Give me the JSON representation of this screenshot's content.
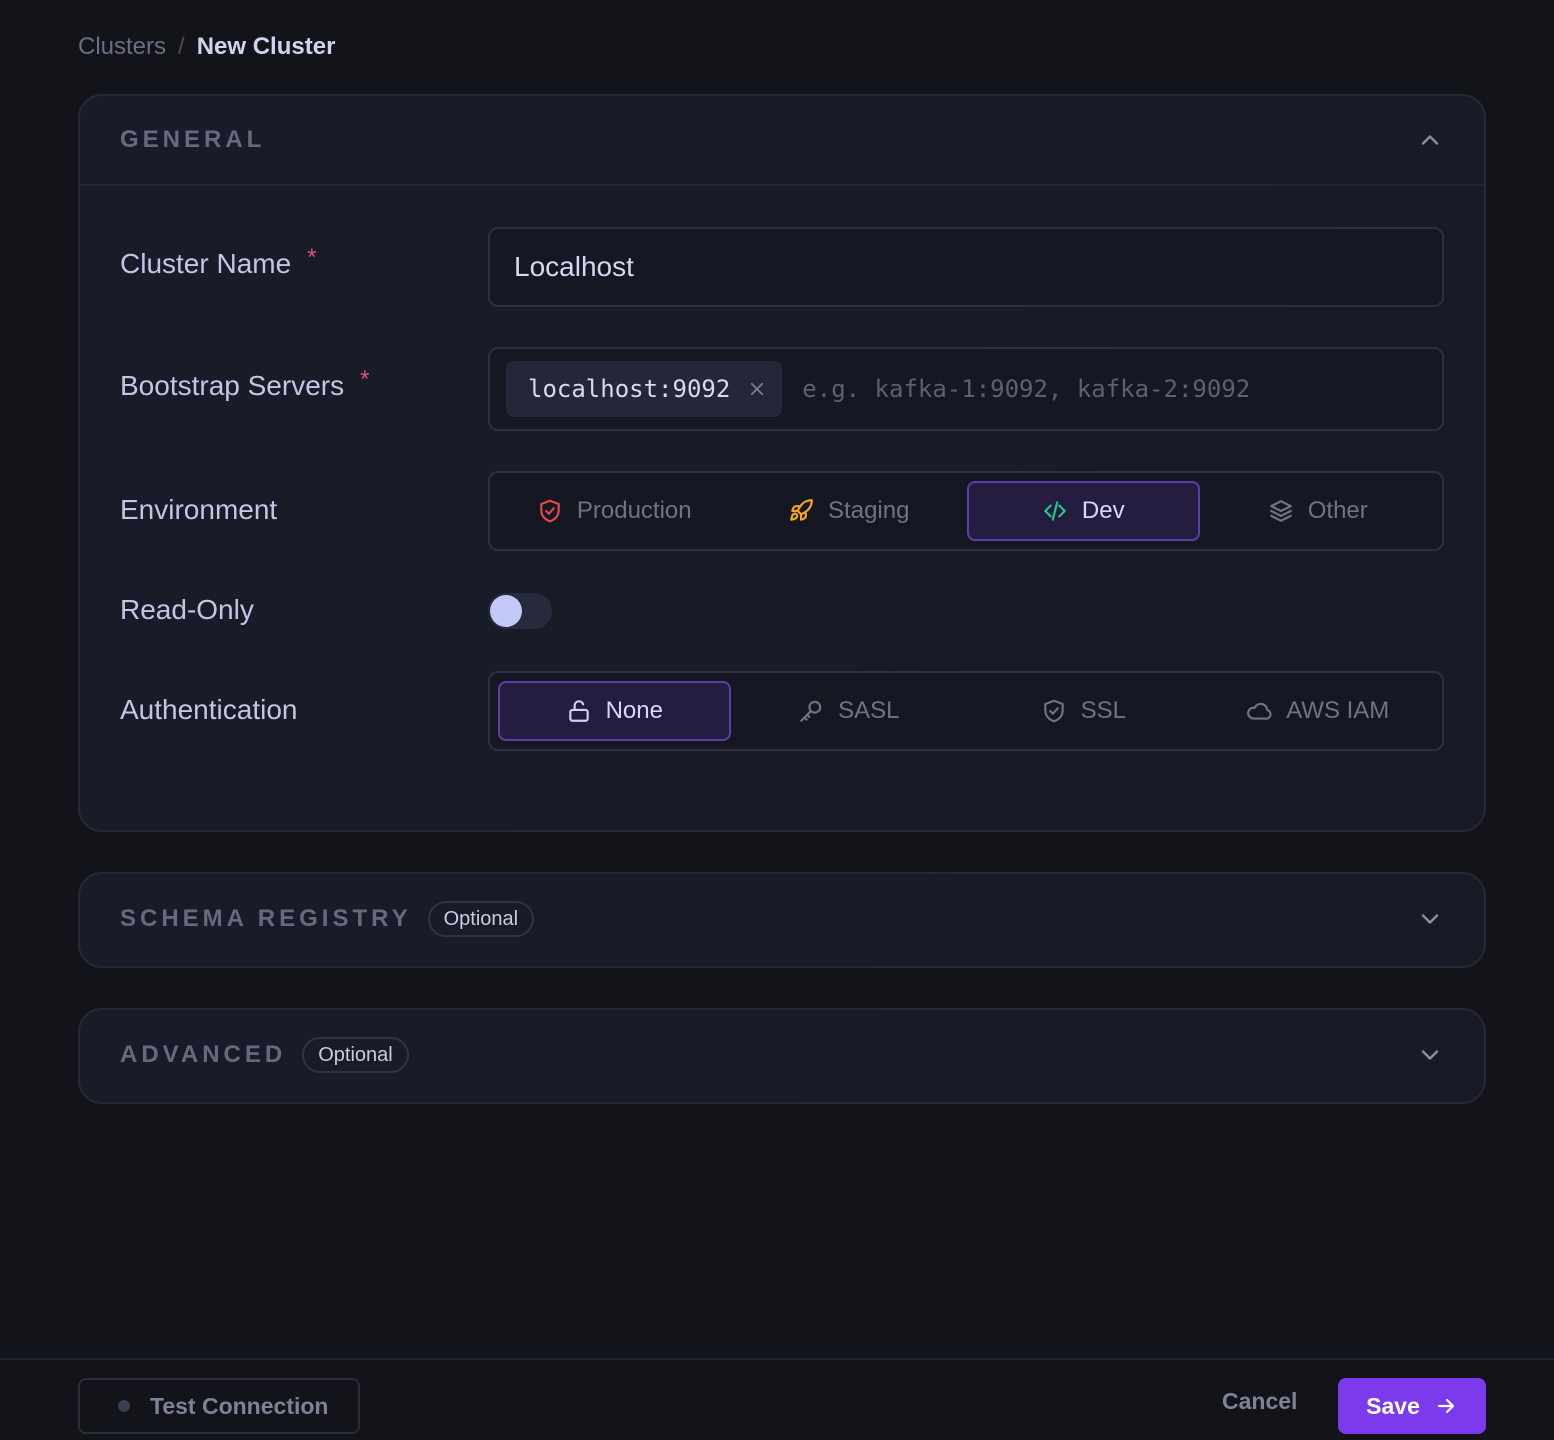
{
  "breadcrumb": {
    "parent": "Clusters",
    "separator": "/",
    "current": "New Cluster"
  },
  "sections": {
    "general": {
      "title": "GENERAL",
      "chevron_icon": "chevron-up-icon"
    },
    "schema_registry": {
      "title": "SCHEMA REGISTRY",
      "badge": "Optional",
      "chevron_icon": "chevron-down-icon"
    },
    "advanced": {
      "title": "ADVANCED",
      "badge": "Optional",
      "chevron_icon": "chevron-down-icon"
    }
  },
  "form": {
    "cluster_name": {
      "label": "Cluster Name",
      "required_mark": "*",
      "value": "Localhost"
    },
    "bootstrap_servers": {
      "label": "Bootstrap Servers",
      "required_mark": "*",
      "tags": [
        "localhost:9092"
      ],
      "placeholder": "e.g. kafka-1:9092, kafka-2:9092"
    },
    "environment": {
      "label": "Environment",
      "options": [
        {
          "label": "Production",
          "icon": "shield-icon",
          "icon_color": "#e5484d"
        },
        {
          "label": "Staging",
          "icon": "rocket-icon",
          "icon_color": "#f5a524"
        },
        {
          "label": "Dev",
          "icon": "code-icon",
          "icon_color": "#2bc48a"
        },
        {
          "label": "Other",
          "icon": "layers-icon",
          "icon_color": "#6e7388"
        }
      ],
      "selected": "Dev"
    },
    "read_only": {
      "label": "Read-Only",
      "enabled": false
    },
    "authentication": {
      "label": "Authentication",
      "options": [
        {
          "label": "None",
          "icon": "unlock-icon"
        },
        {
          "label": "SASL",
          "icon": "key-icon"
        },
        {
          "label": "SSL",
          "icon": "shield-check-icon"
        },
        {
          "label": "AWS IAM",
          "icon": "cloud-icon"
        }
      ],
      "selected": "None"
    }
  },
  "footer": {
    "test_connection": "Test Connection",
    "cancel": "Cancel",
    "save": "Save"
  },
  "colors": {
    "accent": "#7c3aed",
    "required": "#e0527a",
    "background": "#131419"
  }
}
